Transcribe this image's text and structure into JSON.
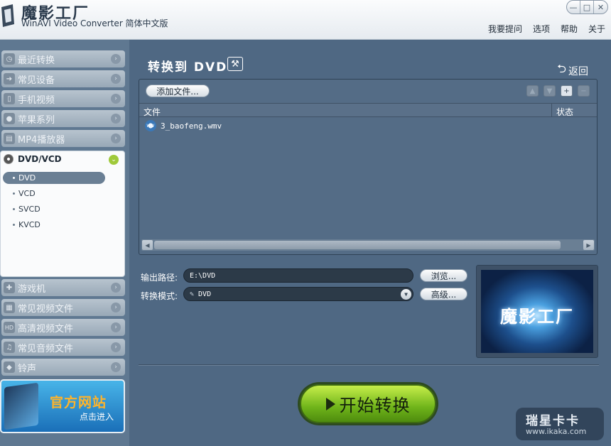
{
  "app": {
    "title": "魔影工厂",
    "subtitle": "WinAVI Video Converter 简体中文版"
  },
  "window_controls": {
    "minimize": "—",
    "maximize": "□",
    "close": "✕"
  },
  "top_menu": [
    "我要提问",
    "选项",
    "帮助",
    "关于"
  ],
  "sidebar": {
    "items_top": [
      {
        "label": "最近转换",
        "icon": "clock-icon",
        "glyph": "◷"
      },
      {
        "label": "常见设备",
        "icon": "arrow-box-icon",
        "glyph": "➔"
      },
      {
        "label": "手机视频",
        "icon": "phone-icon",
        "glyph": "▯"
      },
      {
        "label": "苹果系列",
        "icon": "apple-icon",
        "glyph": "●"
      },
      {
        "label": "MP4播放器",
        "icon": "mp4-player-icon",
        "glyph": "▤"
      }
    ],
    "open_section": {
      "label": "DVD/VCD",
      "subitems": [
        "DVD",
        "VCD",
        "SVCD",
        "KVCD"
      ],
      "selected": "DVD"
    },
    "items_bottom": [
      {
        "label": "游戏机",
        "icon": "gamepad-icon",
        "glyph": "✚"
      },
      {
        "label": "常见视频文件",
        "icon": "film-icon",
        "glyph": "▦"
      },
      {
        "label": "高清视频文件",
        "icon": "hd-icon",
        "glyph": "HD"
      },
      {
        "label": "常见音频文件",
        "icon": "music-icon",
        "glyph": "♫"
      },
      {
        "label": "铃声",
        "icon": "bell-icon",
        "glyph": "◆"
      }
    ],
    "banner": {
      "title": "官方网站",
      "subtitle": "点击进入"
    }
  },
  "main": {
    "title": "转换到 DVD",
    "back_label": "返回",
    "add_file_button": "添加文件...",
    "file_tools": [
      "▲",
      "▼",
      "+",
      "−"
    ],
    "columns": [
      "文件",
      "状态"
    ],
    "files": [
      {
        "name": "3_baofeng.wmv",
        "status": ""
      }
    ],
    "output_path_label": "输出路径:",
    "output_path_value": "E:\\DVD",
    "browse_button": "浏览...",
    "mode_label": "转换模式:",
    "mode_value": "DVD",
    "advanced_button": "高级...",
    "preview_text": "魔影工厂",
    "start_button": "开始转换"
  },
  "watermark": {
    "title": "瑞星卡卡",
    "url": "www.ikaka.com"
  },
  "colors": {
    "main_bg": "#4f6883",
    "sidebar_bg": "#5f7891",
    "start_green": "#6fb41a",
    "banner_orange": "#ffb42a"
  }
}
